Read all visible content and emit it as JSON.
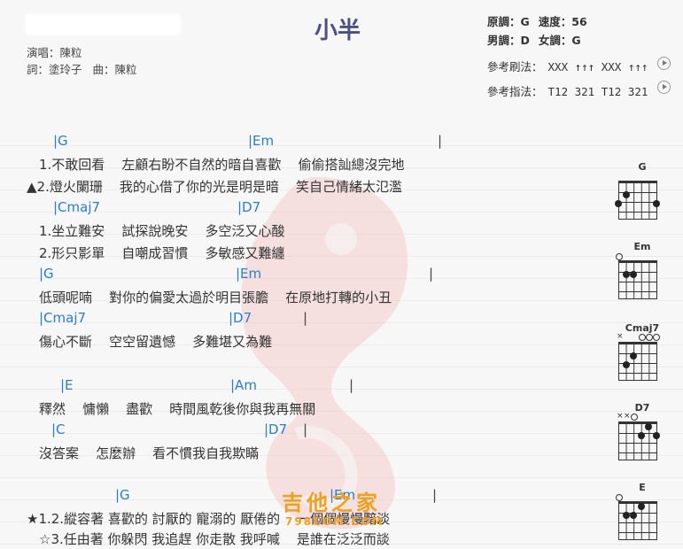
{
  "title": "小半",
  "singer_label": "演唱：陳粒",
  "credits": {
    "lyrics": "詞：塗玲子",
    "music": "曲：陳粒"
  },
  "info": {
    "orig_key": "原調：G",
    "speed": "速度：56",
    "male_key": "男調：D",
    "female_key": "女調：G"
  },
  "strum": {
    "label": "參考刷法：",
    "pattern": "XXX ↑↑↑ XXX ↑↑↑"
  },
  "finger": {
    "label": "參考指法：",
    "pattern": "T12 321 T12 321"
  },
  "chords_line1": [
    "|G",
    "|Em",
    "|"
  ],
  "lyric_1a": "1.不敢回看    左顧右盼不自然的暗自喜歡    偷偷搭訕總沒完地",
  "lyric_1b": "▲2.燈火闌珊    我的心借了你的光是明是暗    笑自己情緒太氾濫",
  "chords_line2": [
    "|Cmaj7",
    "|D7"
  ],
  "lyric_2a": "1.坐立難安    試探說晚安    多空泛又心酸",
  "lyric_2b": "2.形只影單    自嘲成習慣    多敏感又難纏",
  "chords_line3": [
    "|G",
    "|Em",
    "|"
  ],
  "lyric_3": "低頭呢喃    對你的偏愛太過於明目張膽    在原地打轉的小丑",
  "chords_line4": [
    "|Cmaj7",
    "|D7",
    "|"
  ],
  "lyric_4": "傷心不斷    空空留遺憾    多難堪又為難",
  "chords_line5": [
    "|E",
    "|Am",
    "|"
  ],
  "lyric_5": "釋然    慵懶    盡歡    時間風乾後你與我再無關",
  "chords_line6": [
    "|C",
    "|D7",
    "|"
  ],
  "lyric_6": "沒答案    怎麼辦    看不慣我自我欺瞞",
  "chords_line7": [
    "|G",
    "|Em",
    "|"
  ],
  "lyric_7a": "★1.2.縱容著 喜歡的 討厭的 寵溺的 厭倦的    一個個慢慢黯淡",
  "lyric_7b": "☆3.任由著 你躲閃 我追趕 你走散 我呼喊    是誰在泛泛而談",
  "chord_diagrams": [
    "G",
    "Em",
    "Cmaj7",
    "D7",
    "E"
  ],
  "logo_text": "吉他之家",
  "logo_url": "798COM.COM",
  "colors": {
    "chord": "#2b7dc6",
    "title": "#4b4f86",
    "logo": "#f0a020"
  }
}
